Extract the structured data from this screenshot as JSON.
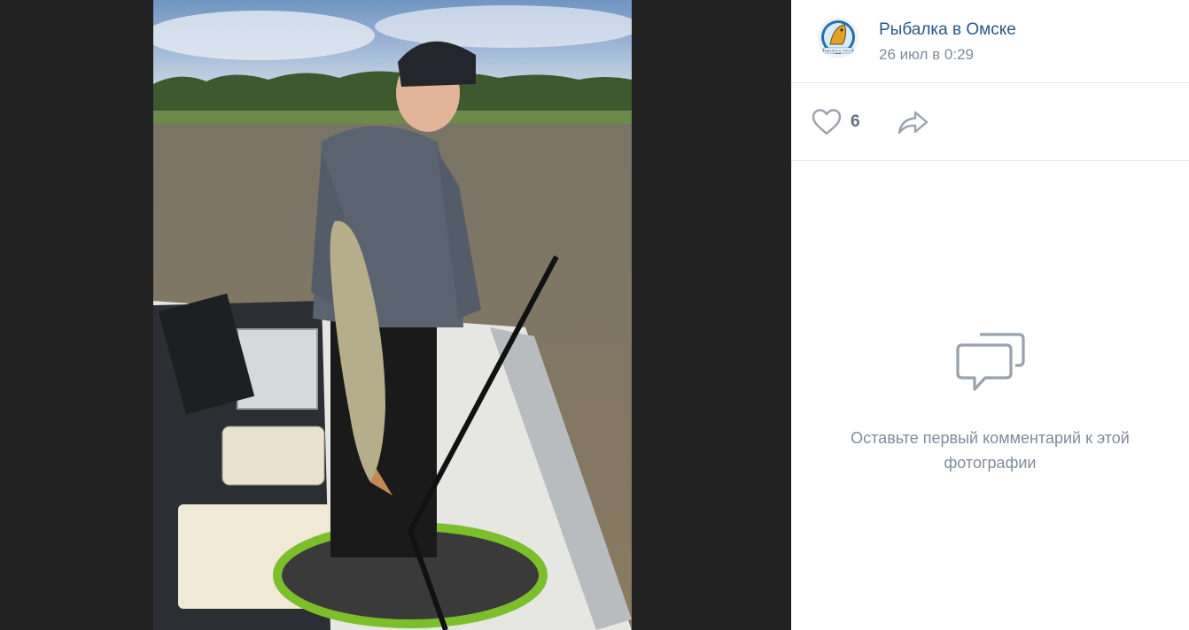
{
  "post": {
    "author": "Рыбалка в Омске",
    "date": "26 июл в 0:29",
    "avatar_icon": "fish-logo-icon",
    "avatar_caption": "РЫБАЛКА В ОМСКЕ"
  },
  "actions": {
    "like_icon": "heart-icon",
    "like_count": "6",
    "share_icon": "share-arrow-icon"
  },
  "comments": {
    "empty_icon": "comments-icon",
    "empty_text": "Оставьте первый комментарий к этой фотографии"
  },
  "colors": {
    "link": "#2a5885",
    "muted": "#818c99",
    "viewer_bg": "#222222",
    "divider": "#e7e8ec"
  }
}
